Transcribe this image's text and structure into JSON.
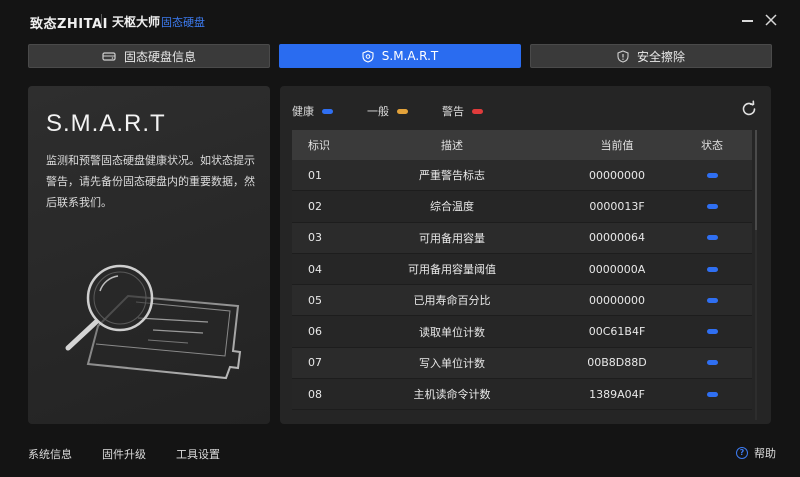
{
  "titlebar": {
    "brand": "致态ZHITAI",
    "app_name": "天枢大师",
    "app_sub": "固态硬盘"
  },
  "tabs": [
    {
      "label": "固态硬盘信息",
      "icon": "drive-icon",
      "active": false
    },
    {
      "label": "S.M.A.R.T",
      "icon": "shield-icon",
      "active": true
    },
    {
      "label": "安全擦除",
      "icon": "shield-alert-icon",
      "active": false
    }
  ],
  "info": {
    "title": "S.M.A.R.T",
    "description": "监测和预警固态硬盘健康状况。如状态提示警告，请先备份固态硬盘内的重要数据，然后联系我们。"
  },
  "legend": [
    {
      "label": "健康",
      "color": "#2f6ff2"
    },
    {
      "label": "一般",
      "color": "#e3a23a"
    },
    {
      "label": "警告",
      "color": "#e03b3b"
    }
  ],
  "table": {
    "headers": {
      "id": "标识",
      "desc": "描述",
      "value": "当前值",
      "status": "状态"
    },
    "rows": [
      {
        "id": "01",
        "desc": "严重警告标志",
        "value": "00000000",
        "status": "健康"
      },
      {
        "id": "02",
        "desc": "综合温度",
        "value": "0000013F",
        "status": "健康"
      },
      {
        "id": "03",
        "desc": "可用备用容量",
        "value": "00000064",
        "status": "健康"
      },
      {
        "id": "04",
        "desc": "可用备用容量阈值",
        "value": "0000000A",
        "status": "健康"
      },
      {
        "id": "05",
        "desc": "已用寿命百分比",
        "value": "00000000",
        "status": "健康"
      },
      {
        "id": "06",
        "desc": "读取单位计数",
        "value": "00C61B4F",
        "status": "健康"
      },
      {
        "id": "07",
        "desc": "写入单位计数",
        "value": "00B8D88D",
        "status": "健康"
      },
      {
        "id": "08",
        "desc": "主机读命令计数",
        "value": "1389A04F",
        "status": "健康"
      }
    ]
  },
  "footer": {
    "system_info": "系统信息",
    "firmware_upgrade": "固件升级",
    "tool_settings": "工具设置",
    "help": "帮助"
  },
  "colors": {
    "accent": "#2a6cf0",
    "healthy": "#2f6ff2",
    "normal": "#e3a23a",
    "warning": "#e03b3b"
  }
}
